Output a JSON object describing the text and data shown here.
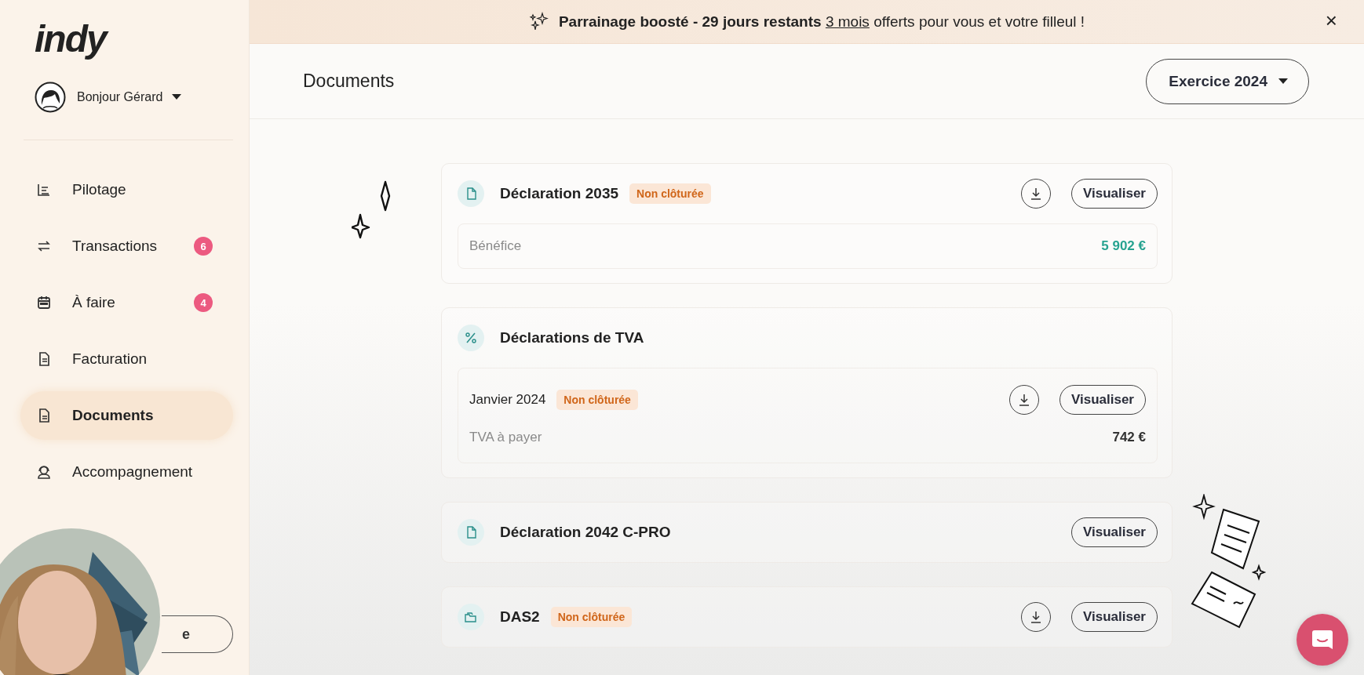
{
  "sidebar": {
    "logo": "indy",
    "greeting": "Bonjour Gérard",
    "items": [
      {
        "label": "Pilotage",
        "selected": false
      },
      {
        "label": "Transactions",
        "badge": "6",
        "selected": false
      },
      {
        "label": "À faire",
        "badge": "4",
        "selected": false
      },
      {
        "label": "Facturation",
        "selected": false
      },
      {
        "label": "Documents",
        "selected": true
      },
      {
        "label": "Accompagnement",
        "selected": false
      }
    ],
    "bottom_button": "e"
  },
  "banner": {
    "lead": "Parrainage boosté - 29 jours restants",
    "link": "3 mois",
    "tail": "offerts pour vous et votre filleul !",
    "close": "×"
  },
  "header": {
    "title": "Documents",
    "year_button": "Exercice 2024"
  },
  "cards": [
    {
      "title": "Déclaration 2035",
      "status": "Non clôturée",
      "download": true,
      "button": "Visualiser",
      "rows": [
        {
          "label": "Bénéfice",
          "value": "5 902 €",
          "positive": true
        }
      ]
    },
    {
      "title": "Déclarations de TVA",
      "download": false,
      "rows": [
        {
          "label": "Janvier 2024",
          "status": "Non clôturée",
          "download": true,
          "button": "Visualiser",
          "sublabel": "TVA à payer",
          "value": "742 €",
          "positive": false
        }
      ]
    },
    {
      "title": "Déclaration 2042 C-PRO",
      "download": false,
      "button": "Visualiser"
    },
    {
      "title": "DAS2",
      "status": "Non clôturée",
      "download": true,
      "button": "Visualiser"
    }
  ]
}
